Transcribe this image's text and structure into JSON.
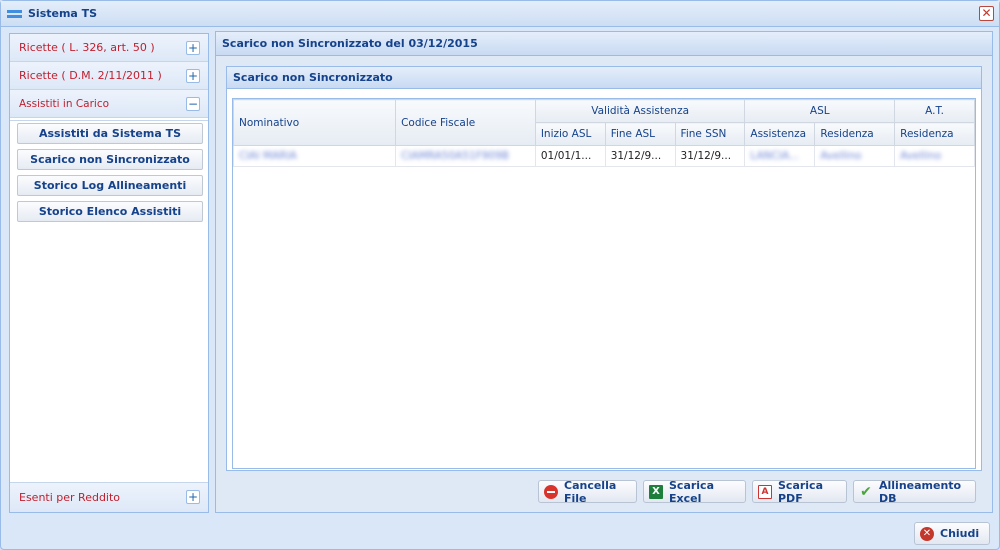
{
  "window": {
    "title": "Sistema TS",
    "close_icon": "close-x-icon"
  },
  "sidebar": {
    "sections": [
      {
        "label": "Ricette ( L. 326, art. 50 )",
        "toggle": "+"
      },
      {
        "label": "Ricette ( D.M. 2/11/2011 )",
        "toggle": "+"
      },
      {
        "label": "Assistiti in Carico",
        "toggle": "−"
      }
    ],
    "items": [
      {
        "label": "Assistiti da Sistema TS"
      },
      {
        "label": "Scarico non Sincronizzato"
      },
      {
        "label": "Storico Log Allineamenti"
      },
      {
        "label": "Storico Elenco Assistiti"
      }
    ],
    "footer": {
      "label": "Esenti per Reddito",
      "toggle": "+"
    }
  },
  "main": {
    "title": "Scarico non Sincronizzato del 03/12/2015",
    "panel_title": "Scarico non Sincronizzato",
    "grid": {
      "group_headers": {
        "validita": "Validità Assistenza",
        "asl": "ASL",
        "at": "A.T."
      },
      "columns": {
        "nominativo": "Nominativo",
        "codice_fiscale": "Codice Fiscale",
        "inizio_asl": "Inizio ASL",
        "fine_asl": "Fine ASL",
        "fine_ssn": "Fine SSN",
        "asl_assistenza": "Assistenza",
        "asl_residenza": "Residenza",
        "at_residenza": "Residenza"
      },
      "rows": [
        {
          "nominativo": "CIAI MARIA",
          "codice_fiscale": "CIAMRA50A51F909B",
          "inizio_asl": "01/01/1...",
          "fine_asl": "31/12/9...",
          "fine_ssn": "31/12/9...",
          "asl_assistenza": "LANCIA...",
          "asl_residenza": "Avellino",
          "at_residenza": "Avellino"
        }
      ]
    },
    "buttons": {
      "cancella": "Cancella File",
      "excel": "Scarica Excel",
      "pdf": "Scarica PDF",
      "allineamento": "Allineamento DB"
    }
  },
  "footer": {
    "chiudi": "Chiudi"
  },
  "colors": {
    "accent": "#15428b",
    "border": "#99bbe8",
    "section_label": "#c0202f"
  }
}
